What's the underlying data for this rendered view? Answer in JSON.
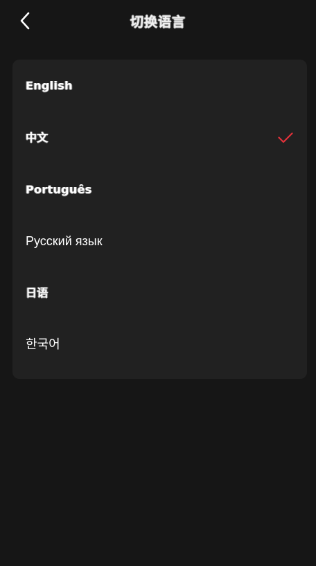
{
  "header": {
    "title": "切换语言",
    "back_icon": "chevron-left-icon"
  },
  "languages": [
    {
      "label": "English",
      "selected": false
    },
    {
      "label": "中文",
      "selected": true
    },
    {
      "label": "Português",
      "selected": false
    },
    {
      "label": "Русский язык",
      "selected": false
    },
    {
      "label": "日语",
      "selected": false
    },
    {
      "label": "한국어",
      "selected": false
    }
  ],
  "colors": {
    "background": "#161616",
    "card": "#212121",
    "text": "#ffffff",
    "check": "#e0313a"
  },
  "icons": {
    "selected": "check-icon"
  }
}
